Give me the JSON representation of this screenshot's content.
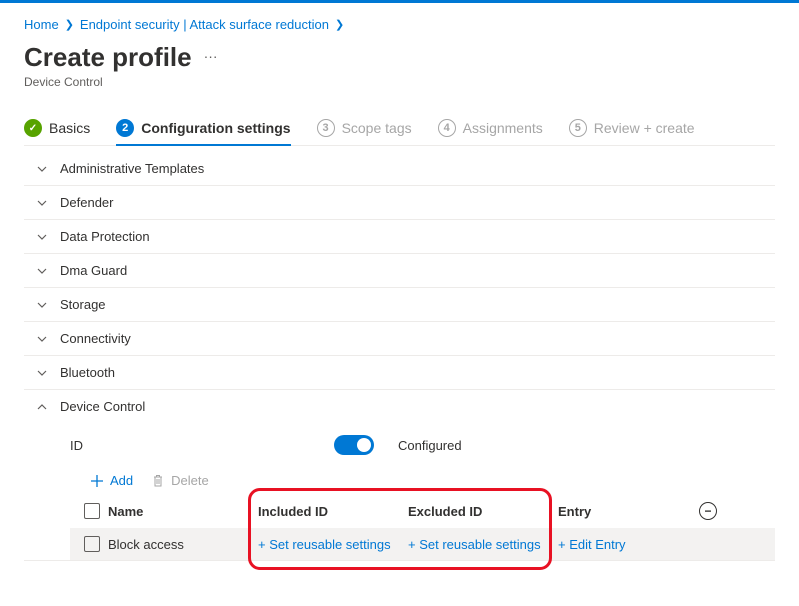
{
  "breadcrumb": {
    "home": "Home",
    "section": "Endpoint security | Attack surface reduction"
  },
  "header": {
    "title": "Create profile",
    "subtitle": "Device Control",
    "more": "···"
  },
  "wizard": {
    "step1": "Basics",
    "step2_num": "2",
    "step2": "Configuration settings",
    "step3_num": "3",
    "step3": "Scope tags",
    "step4_num": "4",
    "step4": "Assignments",
    "step5_num": "5",
    "step5": "Review + create"
  },
  "sections": {
    "s0": "Administrative Templates",
    "s1": "Defender",
    "s2": "Data Protection",
    "s3": "Dma Guard",
    "s4": "Storage",
    "s5": "Connectivity",
    "s6": "Bluetooth",
    "s7": "Device Control"
  },
  "dc": {
    "setting_label": "ID",
    "toggle_state": "Configured",
    "add": "Add",
    "delete": "Delete",
    "cols": {
      "c0": "Name",
      "c1": "Included ID",
      "c2": "Excluded ID",
      "c3": "Entry"
    },
    "row": {
      "name": "Block access",
      "included": "+ Set reusable settings",
      "excluded": "+ Set reusable settings",
      "entry": "+ Edit Entry"
    }
  }
}
